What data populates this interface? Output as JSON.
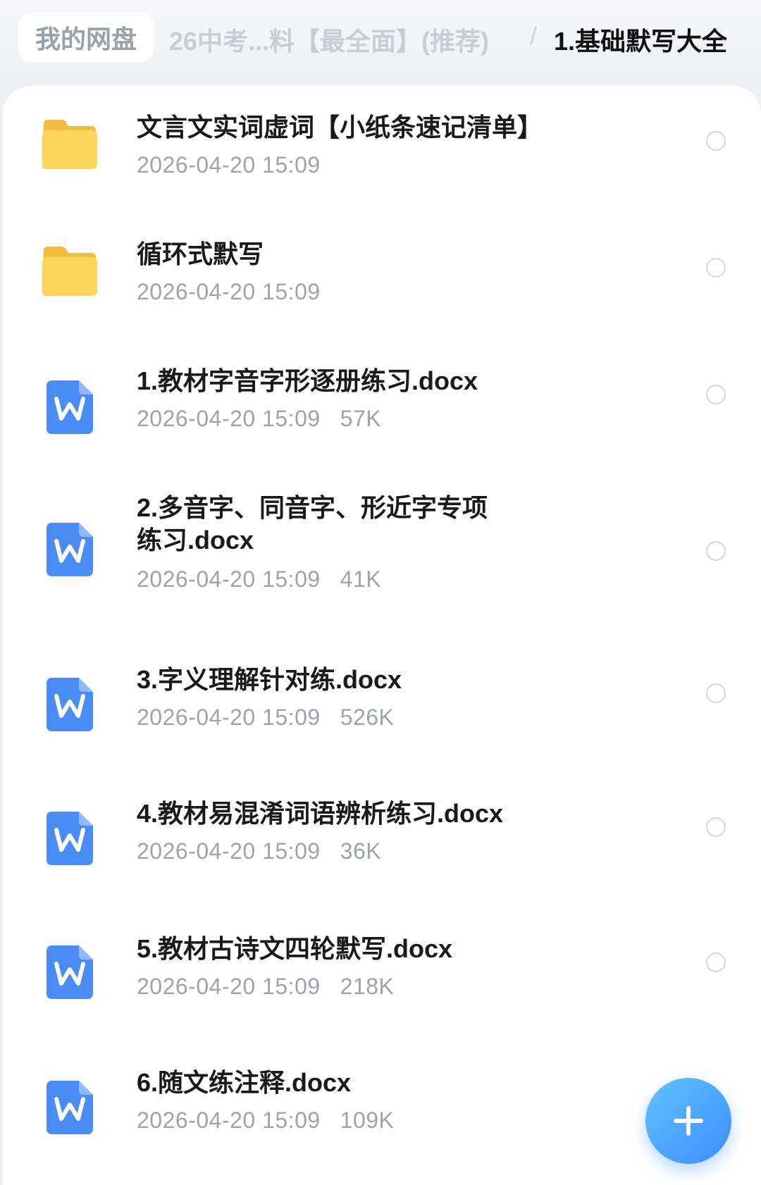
{
  "breadcrumb": {
    "root": "我的网盘",
    "middle": "26中考...料【最全面】(推荐)",
    "separator": "/",
    "current": "1.基础默写大全"
  },
  "files": [
    {
      "type": "folder",
      "name": "文言文实词虚词【小纸条速记清单】",
      "date": "2026-04-20 15:09",
      "size": ""
    },
    {
      "type": "folder",
      "name": "循环式默写",
      "date": "2026-04-20 15:09",
      "size": ""
    },
    {
      "type": "word",
      "name": "1.教材字音字形逐册练习.docx",
      "date": "2026-04-20 15:09",
      "size": "57K"
    },
    {
      "type": "word",
      "name_line1": "2.多音字、同音字、形近字专项",
      "name_line2": "练习.docx",
      "date": "2026-04-20 15:09",
      "size": "41K"
    },
    {
      "type": "word",
      "name": "3.字义理解针对练.docx",
      "date": "2026-04-20 15:09",
      "size": "526K"
    },
    {
      "type": "word",
      "name": "4.教材易混淆词语辨析练习.docx",
      "date": "2026-04-20 15:09",
      "size": "36K"
    },
    {
      "type": "word",
      "name": "5.教材古诗文四轮默写.docx",
      "date": "2026-04-20 15:09",
      "size": "218K"
    },
    {
      "type": "word",
      "name": "6.随文练注释.docx",
      "date": "2026-04-20 15:09",
      "size": "109K"
    }
  ],
  "fab": {
    "icon": "plus-icon"
  },
  "colors": {
    "accent": "#3c8dff",
    "folder": "#ffd25a",
    "word": "#4a8cf5"
  }
}
